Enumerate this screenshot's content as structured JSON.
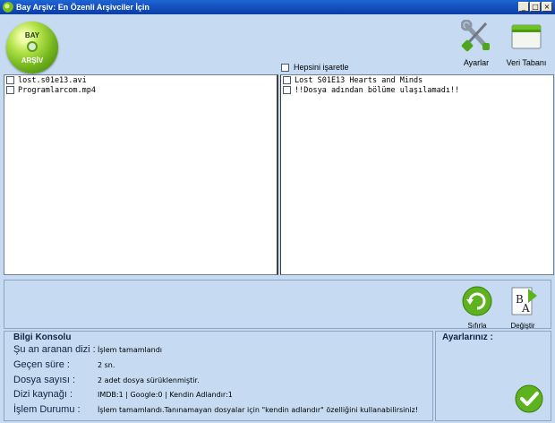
{
  "window": {
    "title": "Bay Arşiv: En Özenli Arşivciler İçin",
    "controls": [
      "_",
      "□",
      "×"
    ]
  },
  "logo": {
    "line1": "BAY",
    "line2": "ARŞİV",
    "icon": "cd-disc-icon"
  },
  "toolbar": {
    "settings_label": "Ayarlar",
    "database_label": "Veri Tabanı"
  },
  "check_all_label": "Hepsini işaretle",
  "left_list": {
    "items": [
      "lost.s01e13.avi",
      "Programlarcom.mp4"
    ]
  },
  "right_list": {
    "items": [
      "Lost S01E13 Hearts and Minds",
      "!!Dosya adından bölüme ulaşılamadı!!"
    ]
  },
  "actions": {
    "reset_label": "Sıfırla",
    "rename_label": "Değiştir"
  },
  "console": {
    "title": "Bilgi Konsolu",
    "rows": [
      {
        "key": "Şu an aranan dizi :",
        "value": "İşlem tamamlandı"
      },
      {
        "key": "Geçen süre :",
        "value": "2 sn."
      },
      {
        "key": "Dosya sayısı :",
        "value": "2 adet dosya sürüklenmiştir."
      },
      {
        "key": "Dizi kaynağı :",
        "value": "IMDB:1 | Google:0 | Kendin Adlandır:1"
      },
      {
        "key": "İşlem Durumu :",
        "value": "İşlem tamamlandı.Tanınamayan dosyalar için \"kendin adlandır\" özelliğini kullanabilirsiniz!"
      }
    ]
  },
  "settings_panel": {
    "title": "Ayarlarınız :"
  },
  "colors": {
    "titlebar": "#0a3da8",
    "background": "#c6daf2",
    "accent_green": "#5cb31e"
  }
}
